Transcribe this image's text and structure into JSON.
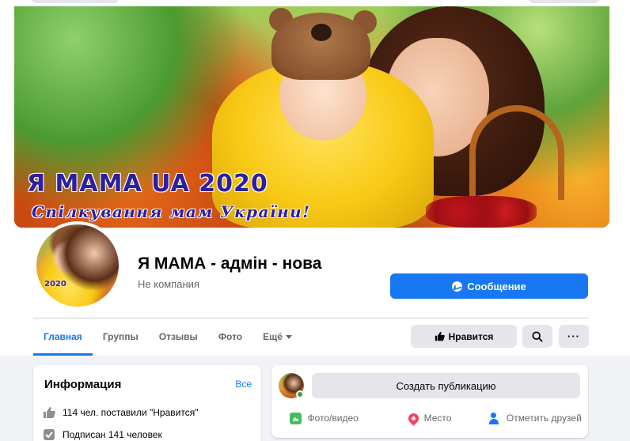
{
  "cover": {
    "title": "Я МАМА UA  2020",
    "subtitle": "Спілкування мам України!"
  },
  "avatar": {
    "year": "2020"
  },
  "page": {
    "name": "Я МАМА - адмін - нова",
    "category": "Не компания"
  },
  "actions": {
    "message_label": "Сообщение",
    "like_label": "Нравится",
    "more_label": "···"
  },
  "tabs": [
    {
      "label": "Главная",
      "active": true
    },
    {
      "label": "Группы"
    },
    {
      "label": "Отзывы"
    },
    {
      "label": "Фото"
    },
    {
      "label": "Ещё"
    }
  ],
  "info": {
    "title": "Информация",
    "all_label": "Все",
    "likes_text": "114 чел. поставили \"Нравится\"",
    "followers_text": "Подписан 141 человек"
  },
  "post": {
    "create_label": "Создать публикацию",
    "photo_label": "Фото/видео",
    "place_label": "Место",
    "tag_label": "Отметить друзей"
  },
  "colors": {
    "accent": "#1877f2",
    "button_gray": "#e4e6eb",
    "background": "#f0f2f5"
  }
}
